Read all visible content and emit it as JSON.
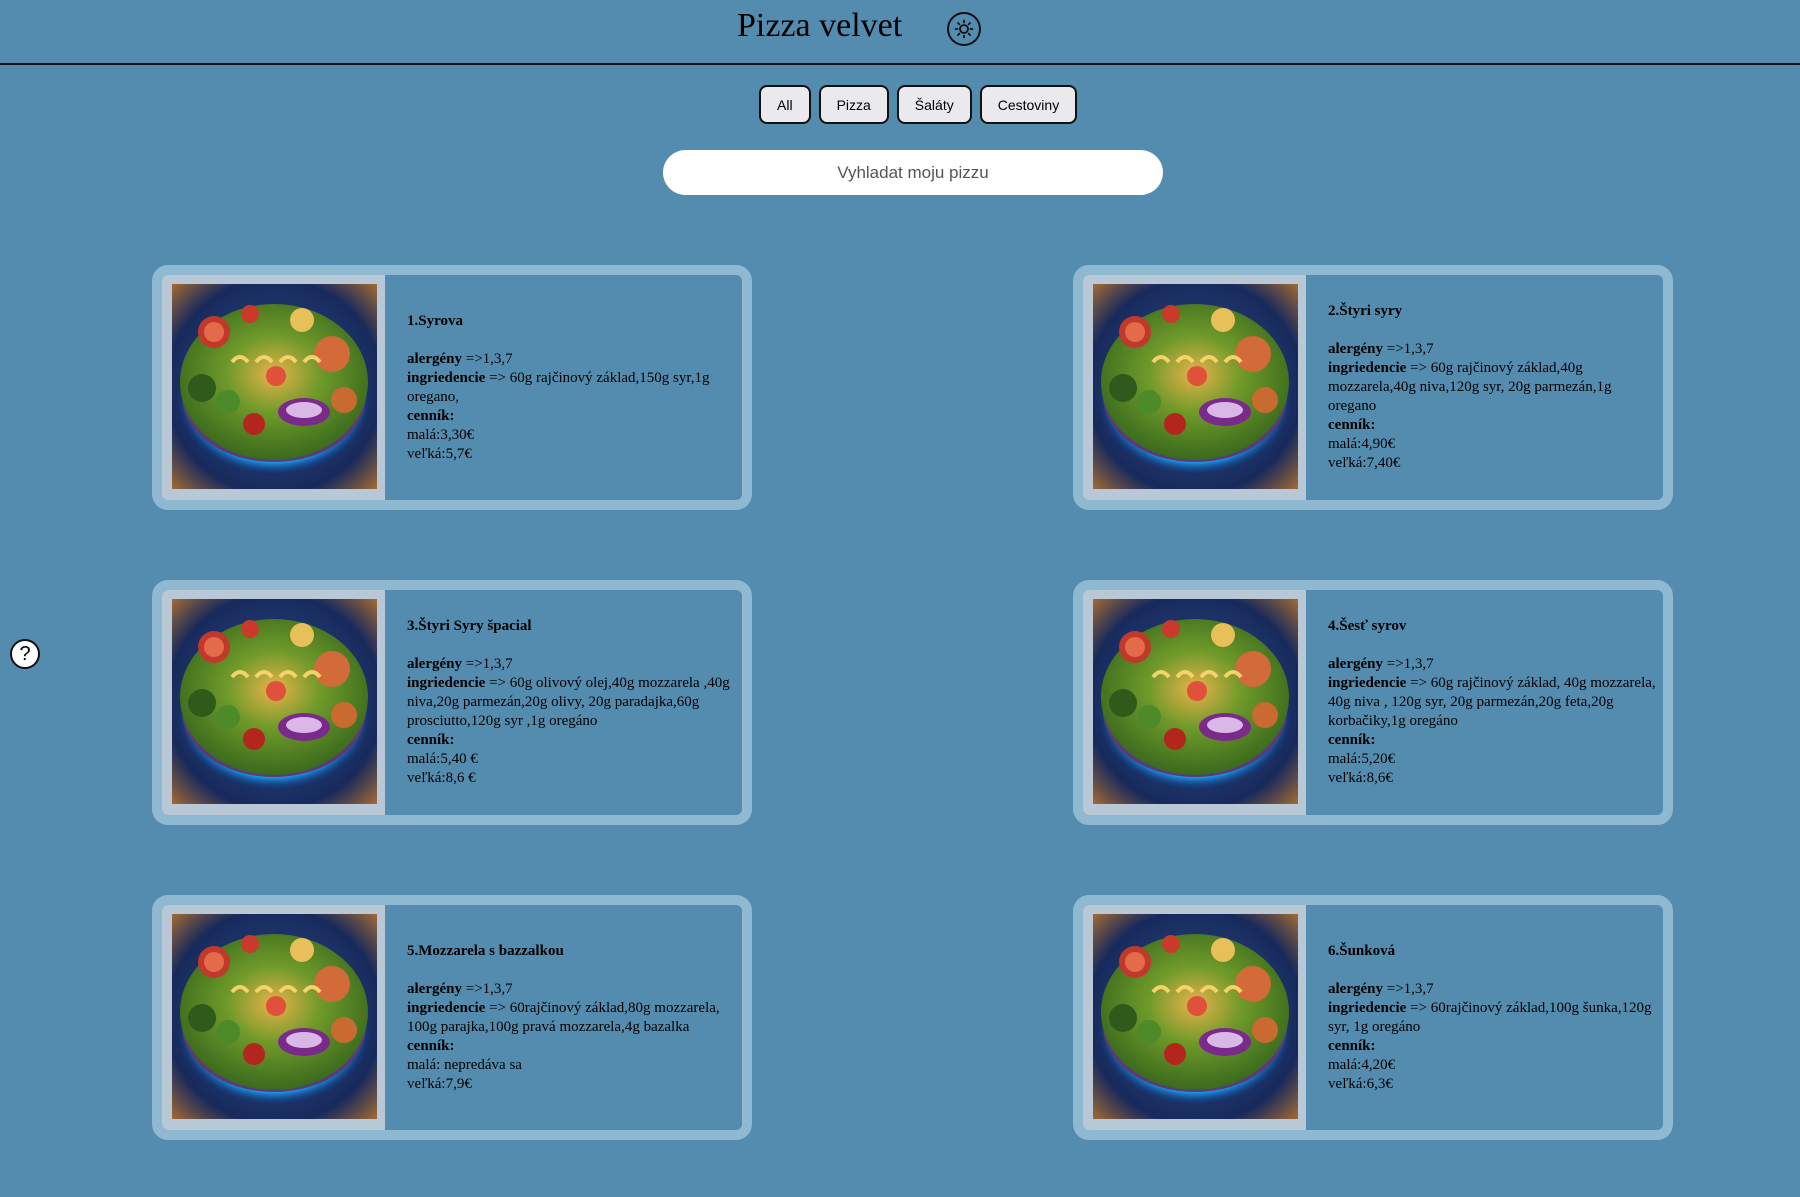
{
  "header": {
    "title": "Pizza velvet",
    "theme_icon": "sun-icon"
  },
  "filters": [
    "All",
    "Pizza",
    "Šaláty",
    "Cestoviny"
  ],
  "search": {
    "placeholder": "Vyhladat moju pizzu"
  },
  "help": {
    "label": "?"
  },
  "labels": {
    "allergens": "alergény",
    "ingredients": "ingriedencie",
    "pricelist": "cenník:"
  },
  "pizzas": [
    {
      "name": "1.Syrova",
      "allergens": "=>1,3,7",
      "ingredients": "=> 60g rajčinový základ,150g syr,1g oregano,",
      "small": "malá:3,30€",
      "large": "veľká:5,7€"
    },
    {
      "name": "2.Štyri syry",
      "allergens": "=>1,3,7",
      "ingredients": "=> 60g rajčinový základ,40g mozzarela,40g niva,120g syr, 20g parmezán,1g oregano",
      "small": "malá:4,90€",
      "large": "veľká:7,40€"
    },
    {
      "name": "3.Štyri Syry špacial",
      "allergens": "=>1,3,7",
      "ingredients": "=> 60g olivový olej,40g mozzarela ,40g niva,20g parmezán,20g olivy, 20g paradajka,60g prosciutto,120g syr ,1g oregáno",
      "small": "malá:5,40 €",
      "large": "veľká:8,6 €"
    },
    {
      "name": "4.Šesť syrov",
      "allergens": "=>1,3,7",
      "ingredients": "=> 60g rajčinový základ, 40g mozzarela, 40g niva , 120g syr, 20g parmezán,20g feta,20g korbačiky,1g oregáno",
      "small": "malá:5,20€",
      "large": "veľká:8,6€"
    },
    {
      "name": "5.Mozzarela s bazzalkou",
      "allergens": "=>1,3,7",
      "ingredients": "=> 60rajčinový základ,80g mozzarela, 100g parajka,100g pravá mozzarela,4g bazalka",
      "small": "malá: nepredáva sa",
      "large": "veľká:7,9€"
    },
    {
      "name": "6.Šunková",
      "allergens": "=>1,3,7",
      "ingredients": "=> 60rajčinový základ,100g šunka,120g syr, 1g oregáno",
      "small": "malá:4,20€",
      "large": "veľká:6,3€"
    }
  ]
}
